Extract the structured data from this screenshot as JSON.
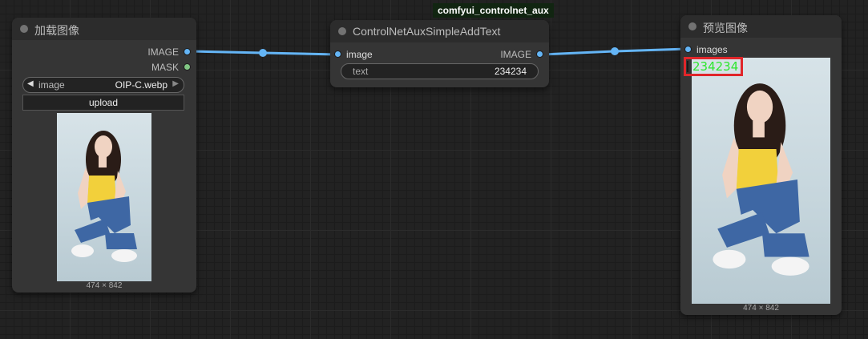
{
  "group": {
    "label": "comfyui_controlnet_aux"
  },
  "load_node": {
    "title": "加载图像",
    "outputs": [
      "IMAGE",
      "MASK"
    ],
    "image_combo": {
      "name": "image",
      "value": "OIP-C.webp"
    },
    "upload_label": "upload",
    "dims": "474 × 842"
  },
  "aux_node": {
    "title": "ControlNetAuxSimpleAddText",
    "input": "image",
    "output": "IMAGE",
    "text_field": {
      "name": "text",
      "value": "234234"
    }
  },
  "preview_node": {
    "title": "预览图像",
    "input": "images",
    "overlay_text": "234234",
    "dims": "474 × 842"
  },
  "colors": {
    "image_slot": "#64b5f6",
    "mask_slot": "#81c784",
    "link": "#64b5f6",
    "highlight": "#e0262a",
    "overlay_text": "#2ee62e"
  }
}
